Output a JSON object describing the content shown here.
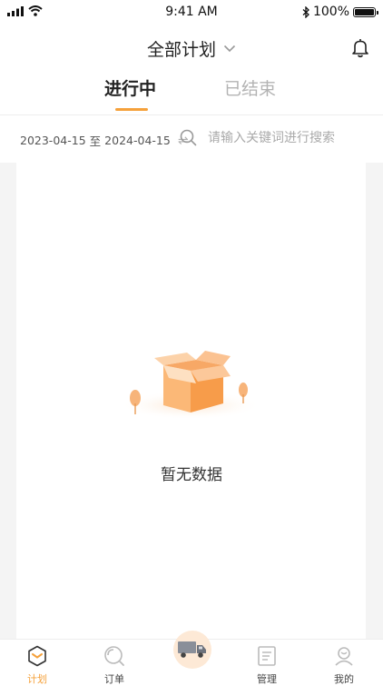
{
  "status_bar": {
    "time": "9:41 AM",
    "battery": "100%",
    "battery_level": 1.0
  },
  "header": {
    "title": "全部计划",
    "icons": [
      "chevron-down-icon",
      "bell-icon"
    ]
  },
  "tabs": [
    {
      "label": "进行中",
      "active": true
    },
    {
      "label": "已结束",
      "active": false
    }
  ],
  "filter": {
    "date_start": "2023-04-15",
    "date_separator": "至",
    "date_end": "2024-04-15",
    "search_placeholder": "请输入关键词进行搜索"
  },
  "empty_state": {
    "text": "暂无数据",
    "icon": "empty-box-icon"
  },
  "tab_bar": [
    {
      "label": "计划",
      "icon": "plan-icon",
      "active": true
    },
    {
      "label": "订单",
      "icon": "order-icon",
      "active": false
    },
    {
      "label": "",
      "icon": "truck-icon",
      "active": false
    },
    {
      "label": "管理",
      "icon": "manage-icon",
      "active": false
    },
    {
      "label": "我的",
      "icon": "profile-icon",
      "active": false
    }
  ],
  "colors": {
    "accent": "#f5a13b",
    "inactive_tab": "#b3b3b3",
    "content_bg": "#f4f4f4"
  }
}
